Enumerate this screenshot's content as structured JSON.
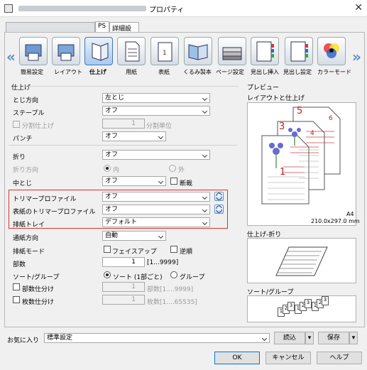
{
  "window": {
    "title": "プロパティ",
    "close_glyph": "✕"
  },
  "tabs": [
    {
      "label": ""
    },
    {
      "label": "PS"
    },
    {
      "label": "詳細設定"
    }
  ],
  "toolbar": {
    "items": [
      {
        "label": "簡易設定",
        "icon": "quick-setup-icon"
      },
      {
        "label": "レイアウト",
        "icon": "layout-icon"
      },
      {
        "label": "仕上げ",
        "icon": "finishing-icon"
      },
      {
        "label": "用紙",
        "icon": "paper-icon"
      },
      {
        "label": "表紙",
        "icon": "cover-icon"
      },
      {
        "label": "くるみ製本",
        "icon": "perfect-binding-icon"
      },
      {
        "label": "ページ設定",
        "icon": "page-setup-icon"
      },
      {
        "label": "見出し挿入",
        "icon": "tab-insert-icon"
      },
      {
        "label": "見出し設定",
        "icon": "tab-setting-icon"
      },
      {
        "label": "カラーモード",
        "icon": "color-mode-icon"
      }
    ]
  },
  "finishing": {
    "section_title": "仕上げ",
    "binding_label": "とじ方向",
    "binding_value": "左とじ",
    "staple_label": "ステープル",
    "staple_value": "オフ",
    "split_label": "分割仕上げ",
    "split_value": "1",
    "split_unit": "分割単位",
    "punch_label": "パンチ",
    "punch_value": "オフ",
    "fold_label": "折り",
    "fold_value": "オフ",
    "fold_dir_label": "折り方向",
    "fold_in": "内",
    "fold_out": "外",
    "center_binding_label": "中とじ",
    "center_binding_value": "オフ",
    "cut_label": "断裁",
    "trimmer_label": "トリマープロファイル",
    "trimmer_value": "オフ",
    "cover_trimmer_label": "表紙のトリマープロファイル",
    "cover_trimmer_value": "オフ",
    "output_tray_label": "排紙トレイ",
    "output_tray_value": "デフォルト",
    "feed_dir_label": "通紙方向",
    "feed_dir_value": "自動",
    "output_mode_label": "排紙モード",
    "faceup_label": "フェイスアップ",
    "reverse_label": "逆順",
    "copies_label": "部数",
    "copies_value": "1",
    "copies_range": "[1...9999]",
    "sort_label": "ソート/グループ",
    "sort_option": "ソート (1部ごと)",
    "group_option": "グループ",
    "set_split_label": "部数仕分け",
    "set_split_value": "1",
    "set_split_hint": "部数[1....9999]",
    "sheet_split_label": "枚数仕分け",
    "sheet_split_value": "1",
    "sheet_split_hint": "枚数[1....65535]"
  },
  "preview": {
    "section_title": "プレビュー",
    "layout_title": "レイアウトと仕上げ",
    "page_numbers": [
      "1",
      "3",
      "4",
      "5",
      "6"
    ],
    "paper_name": "A4",
    "paper_size": "210.0x297.0 mm",
    "fold_title": "仕上げ-折り",
    "sort_title": "ソート/グループ",
    "sort_sets": [
      [
        "1",
        "2",
        "3"
      ],
      [
        "1",
        "2",
        "3"
      ],
      [
        "1",
        "2",
        "3"
      ]
    ]
  },
  "favorites": {
    "label": "お気に入り",
    "value": "標準設定",
    "load_label": "読込",
    "save_label": "保存"
  },
  "buttons": {
    "ok": "OK",
    "cancel": "キャンセル",
    "help": "ヘルプ"
  },
  "colors": {
    "accent": "#3b78c4",
    "highlight_border": "#e03030",
    "page_number": "#c02020"
  }
}
